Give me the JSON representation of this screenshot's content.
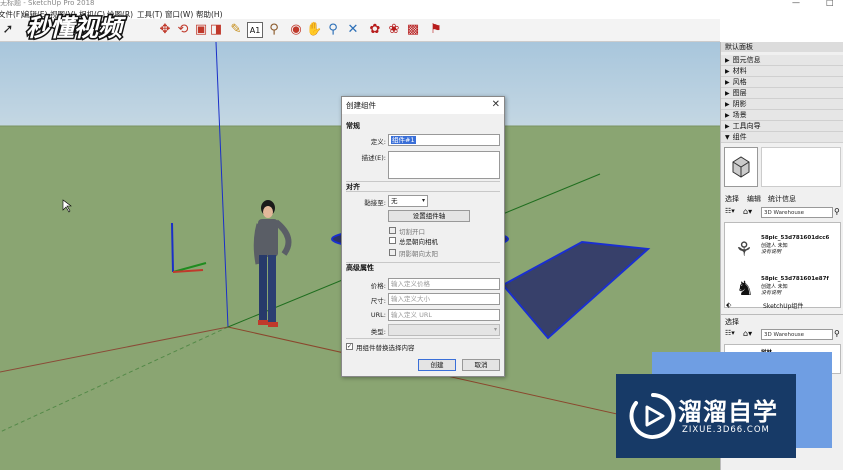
{
  "window": {
    "title": "无标题 - SketchUp Pro 2018",
    "controls": [
      "—",
      "□"
    ]
  },
  "menu": [
    "文件(F)",
    "编辑(E)",
    "视图(V)",
    "相机(C)",
    "绘图(R)",
    "工具(T)",
    "窗口(W)",
    "帮助(H)"
  ],
  "toolbar": {
    "icons": [
      "select-icon",
      "pencil-icon",
      "eraser-icon",
      "push-pull-icon",
      "move-icon",
      "rotate-icon",
      "scale-icon",
      "tape-measure-icon",
      "text-icon",
      "axes-icon",
      "dimension-icon",
      "protractor-icon",
      "orbit-icon",
      "pan-icon",
      "zoom-icon",
      "zoom-extents-icon",
      "warehouse-icon",
      "extension-icon",
      "share-icon",
      "send-icon"
    ]
  },
  "watermark_logo_text": "秒懂视频",
  "right_panel": {
    "title": "默认面板",
    "trays": [
      "图元信息",
      "材料",
      "风格",
      "图层",
      "阴影",
      "场景",
      "工具向导"
    ],
    "components_tray": "组件",
    "tabs": [
      "选择",
      "编辑",
      "统计信息"
    ],
    "search_value": "3D Warehouse",
    "items": [
      {
        "name": "58pic_53d781601dcc6",
        "author": "创建人 未知",
        "desc": "没有说明"
      },
      {
        "name": "58pic_53d781601e87f",
        "author": "创建人 未知",
        "desc": "没有说明"
      }
    ],
    "footer_label": "SketchUp组件",
    "second_select_label": "选择",
    "second_search_value": "3D Warehouse",
    "second_item_name": "树林"
  },
  "dialog": {
    "title": "创建组件",
    "section_general": "常规",
    "definition_label": "定义:",
    "definition_value": "组件#1",
    "description_label": "描述(E):",
    "section_align": "对齐",
    "glue_label": "黏接至:",
    "glue_value": "无",
    "set_axes_button": "设置组件轴",
    "cut_opening": "切割开口",
    "face_camera": "总是朝向相机",
    "shadows_face_sun": "阴影朝向太阳",
    "section_advanced": "高级属性",
    "price_label": "价格:",
    "price_placeholder": "输入定义价格",
    "size_label": "尺寸:",
    "size_placeholder": "输入定义大小",
    "url_label": "URL:",
    "url_placeholder": "输入定义 URL",
    "type_label": "类型:",
    "replace_selection": "用组件替换选择内容",
    "create_button": "创建",
    "cancel_button": "取消"
  },
  "watermark": {
    "brand": "溜溜自学",
    "url": "ZIXUE.3D66.COM"
  }
}
